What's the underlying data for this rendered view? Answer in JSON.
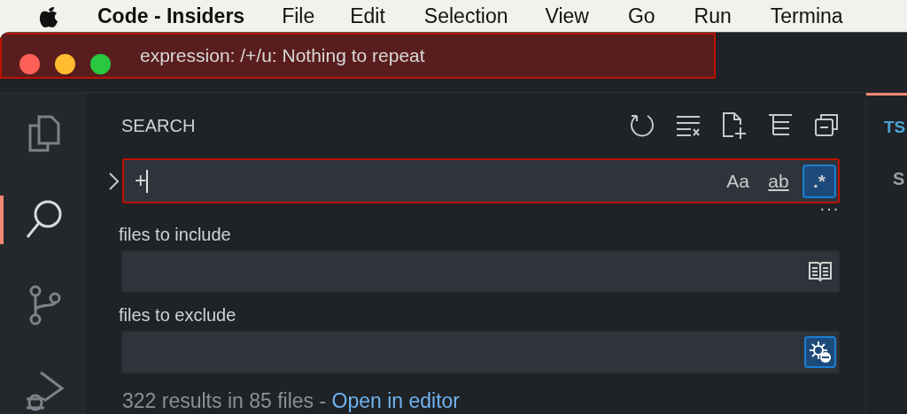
{
  "menu_bar": {
    "app_name": "Code - Insiders",
    "items": [
      "File",
      "Edit",
      "Selection",
      "View",
      "Go",
      "Run",
      "Termina"
    ]
  },
  "error_banner": {
    "message": "expression: /+/u: Nothing to repeat"
  },
  "activity_bar": {
    "items": [
      {
        "kind": "files",
        "selected": false
      },
      {
        "kind": "search",
        "selected": true
      },
      {
        "kind": "source-control",
        "selected": false
      },
      {
        "kind": "debug",
        "selected": false
      }
    ]
  },
  "search": {
    "title": "SEARCH",
    "details_expanded": false,
    "query": "+",
    "invalid": true,
    "toggles": [
      {
        "kind": "case",
        "label": "Aa",
        "selected": false
      },
      {
        "kind": "word",
        "label": "ab",
        "selected": false
      },
      {
        "kind": "regex",
        "label": ".*",
        "selected": true
      }
    ],
    "more": "···",
    "include": {
      "label": "files to include",
      "only_open_editors": false
    },
    "exclude": {
      "label": "files to exclude",
      "use_exclude_settings": true
    },
    "summary": "322 results in 85 files - ",
    "link": "Open in editor"
  },
  "editor": {
    "tab": "TS",
    "line": "S"
  }
}
